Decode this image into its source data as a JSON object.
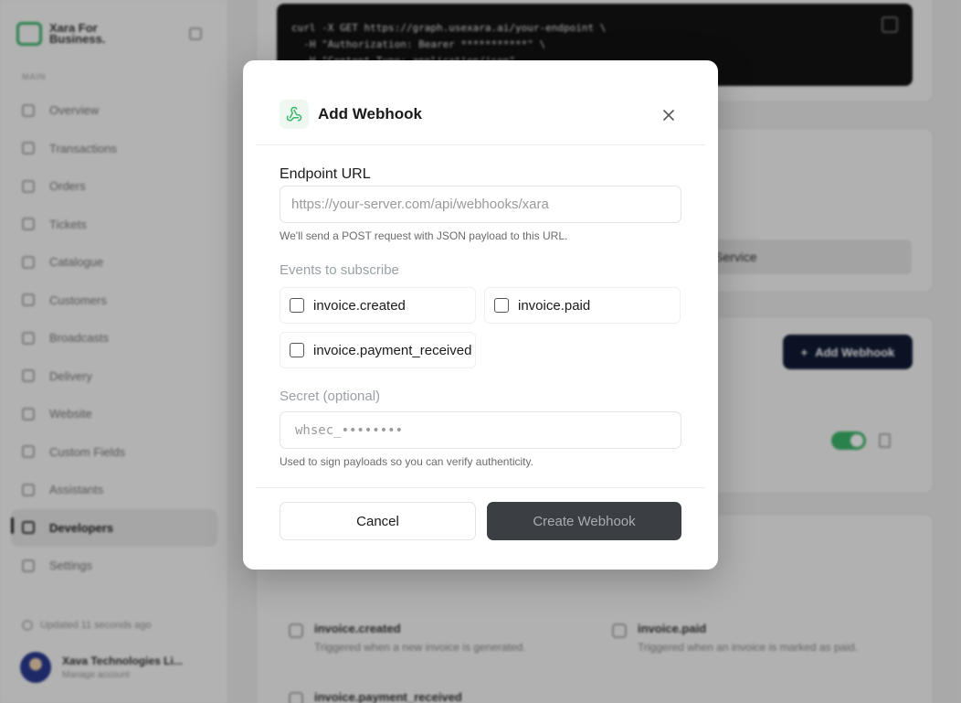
{
  "sidebar": {
    "brand": "Xara For Business.",
    "section_label": "MAIN",
    "items": [
      {
        "label": "Overview",
        "icon": "grid-icon"
      },
      {
        "label": "Transactions",
        "icon": "trend-icon"
      },
      {
        "label": "Orders",
        "icon": "orders-icon"
      },
      {
        "label": "Tickets",
        "icon": "ticket-icon"
      },
      {
        "label": "Catalogue",
        "icon": "catalogue-icon"
      },
      {
        "label": "Customers",
        "icon": "users-icon"
      },
      {
        "label": "Broadcasts",
        "icon": "broadcast-icon"
      },
      {
        "label": "Delivery",
        "icon": "truck-icon"
      },
      {
        "label": "Website",
        "icon": "globe-icon"
      },
      {
        "label": "Custom Fields",
        "icon": "fields-icon"
      },
      {
        "label": "Assistants",
        "icon": "assistant-icon"
      },
      {
        "label": "Developers",
        "icon": "code-icon",
        "active": true
      },
      {
        "label": "Settings",
        "icon": "gear-icon"
      }
    ],
    "updated": "Updated 11 seconds ago",
    "account": {
      "name": "Xava Technologies Li...",
      "sub": "Manage account"
    }
  },
  "background": {
    "code": "curl -X GET https://graph.usexara.ai/your-endpoint \\\n  -H \"Authorization: Bearer ***********\" \\\n  -H \"Content-Type: application/json\"",
    "service_label": "Service",
    "add_webhook_label": "Add Webhook",
    "events": [
      {
        "title": "invoice.created",
        "desc": "Triggered when a new invoice is generated."
      },
      {
        "title": "invoice.paid",
        "desc": "Triggered when an invoice is marked as paid."
      },
      {
        "title": "invoice.payment_received",
        "desc": ""
      }
    ]
  },
  "modal": {
    "title": "Add Webhook",
    "endpoint_label": "Endpoint URL",
    "endpoint_placeholder": "https://your-server.com/api/webhooks/xara",
    "endpoint_value": "",
    "endpoint_help": "We'll send a POST request with JSON payload to this URL.",
    "events_label": "Events to subscribe",
    "events": [
      {
        "label": "invoice.created",
        "checked": false
      },
      {
        "label": "invoice.paid",
        "checked": false
      },
      {
        "label": "invoice.payment_received",
        "checked": false
      }
    ],
    "secret_label": "Secret (optional)",
    "secret_placeholder": "whsec_••••••••",
    "secret_help": "Used to sign payloads so you can verify authenticity.",
    "cancel_label": "Cancel",
    "create_label": "Create Webhook"
  },
  "colors": {
    "accent": "#3bb36a",
    "create_button_bg": "#3b3f44",
    "dark_button": "#101a33"
  }
}
